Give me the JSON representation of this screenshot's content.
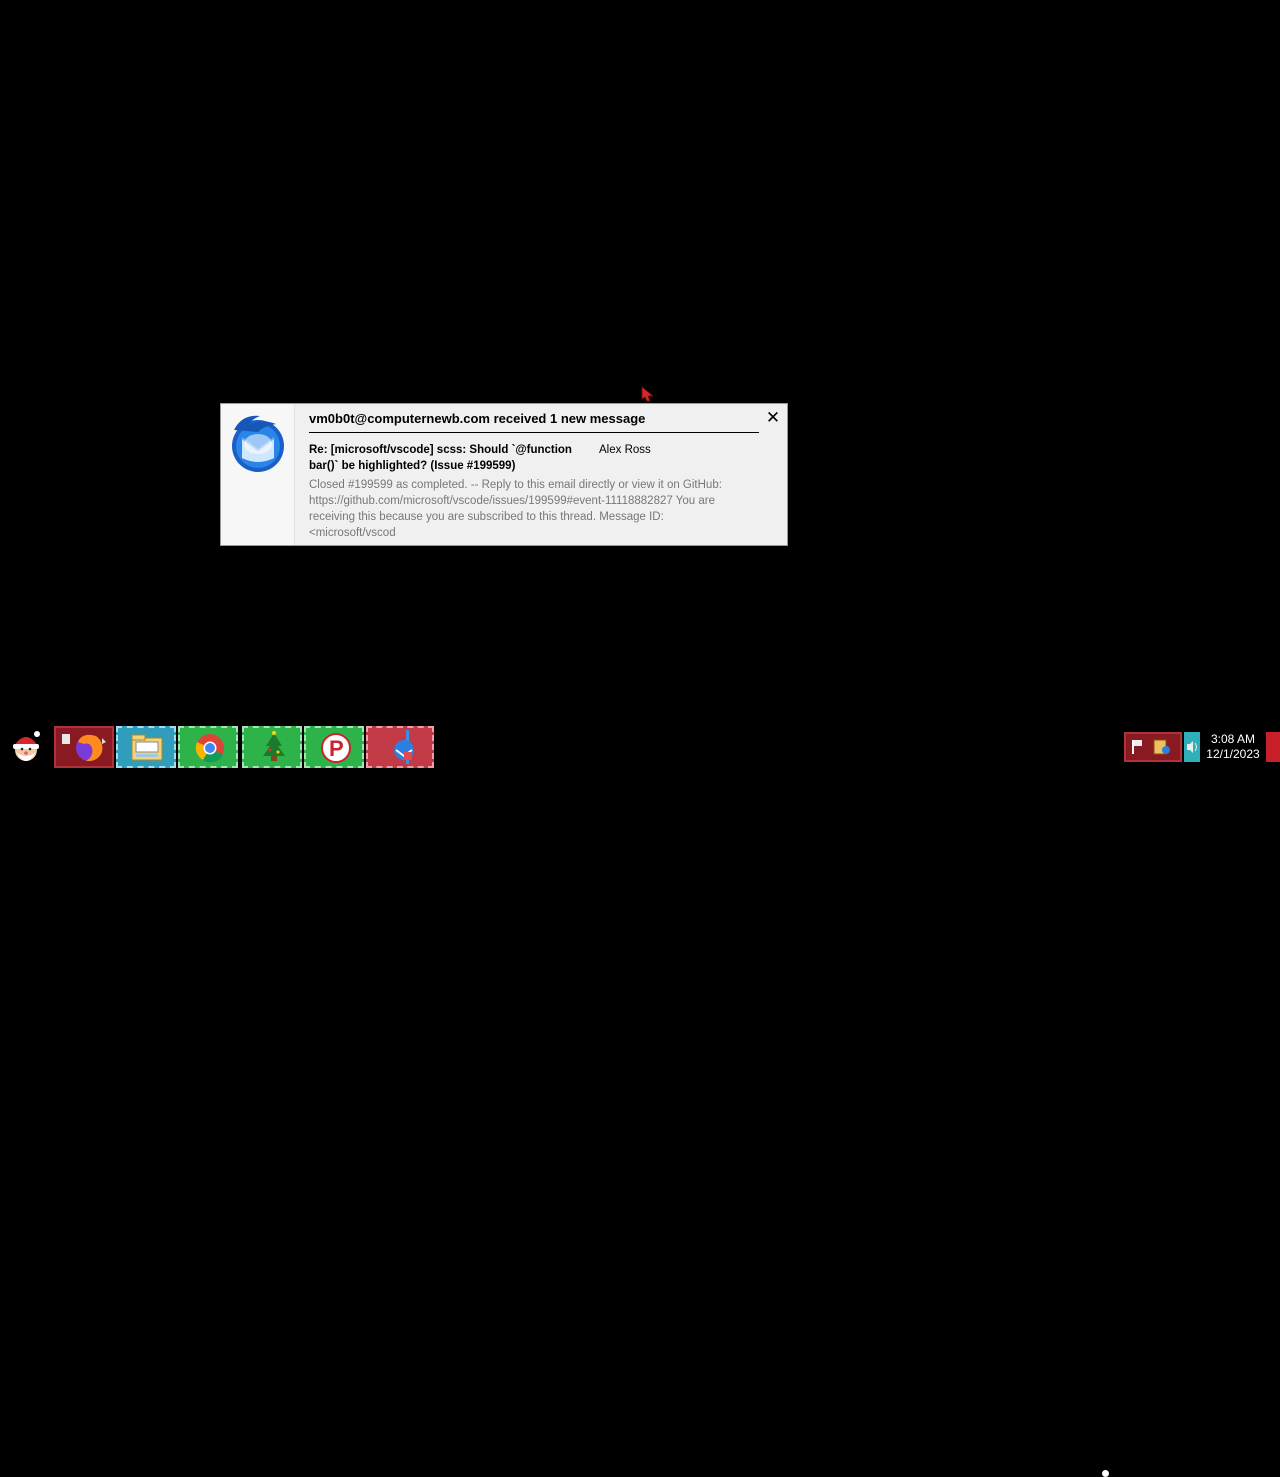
{
  "notification": {
    "header": "vm0b0t@computernewb.com received 1 new message",
    "close_glyph": "✕",
    "subject": "Re: [microsoft/vscode] scss: Should `@function bar()` be highlighted? (Issue #199599)",
    "sender": "Alex Ross",
    "preview": "Closed #199599 as completed. -- Reply to this email directly or view it on GitHub: https://github.com/microsoft/vscode/issues/199599#event-11118882827 You are receiving this because you are subscribed to this thread. Message ID: <microsoft/vscod",
    "icon": "thunderbird-icon"
  },
  "taskbar": {
    "start_icon": "santa-start-icon",
    "apps": [
      {
        "name": "firefox",
        "icon": "firefox-icon"
      },
      {
        "name": "file-explorer",
        "icon": "folder-icon"
      },
      {
        "name": "chrome",
        "icon": "chrome-icon"
      },
      {
        "name": "tree-app",
        "icon": "christmas-tree-icon"
      },
      {
        "name": "p-app",
        "icon": "p-app-icon"
      },
      {
        "name": "thunderbird",
        "icon": "thunderbird-icon"
      }
    ],
    "tray": {
      "time": "3:08 AM",
      "date": "12/1/2023"
    }
  },
  "colors": {
    "desktop": "#000000",
    "notification_bg": "#f0f0f0",
    "preview_text": "#777777",
    "thunderbird_blue": "#1f6fd6"
  }
}
